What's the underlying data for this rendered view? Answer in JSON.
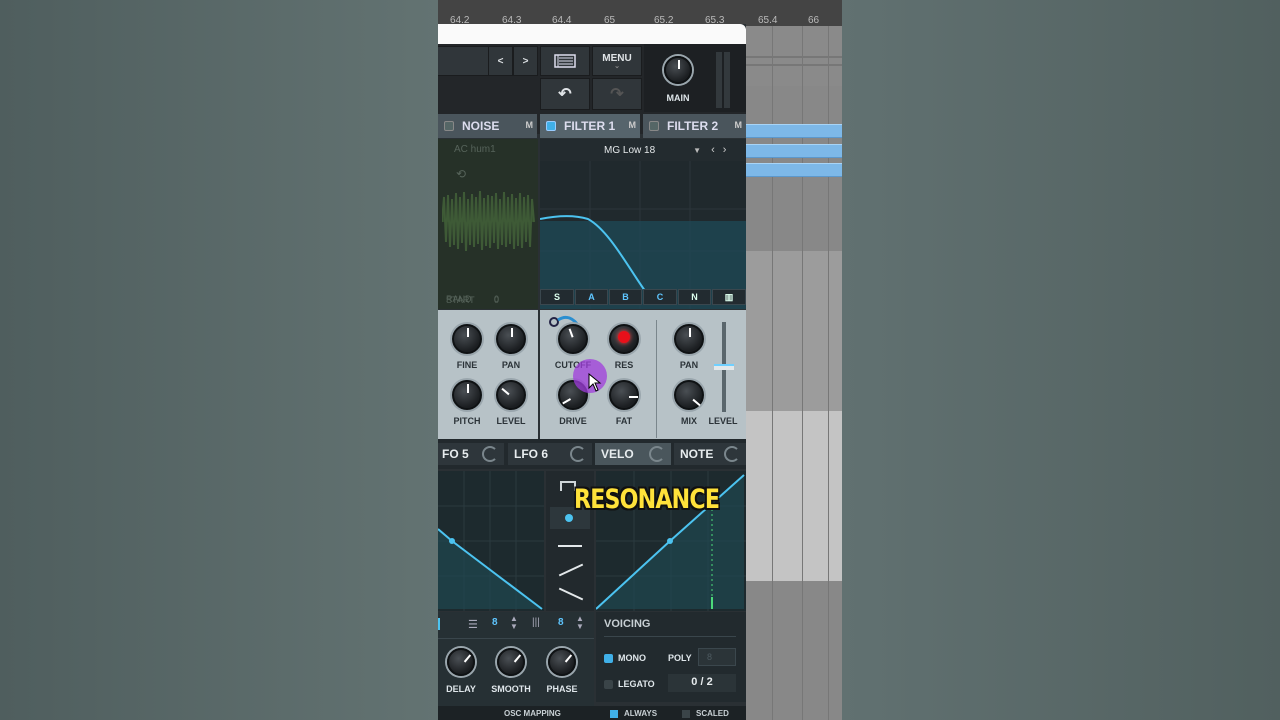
{
  "ruler": {
    "ticks": [
      "64.2",
      "64.3",
      "64.4",
      "65",
      "65.2",
      "65.3",
      "65.4",
      "66"
    ]
  },
  "toolbar": {
    "menu_label": "MENU",
    "main_label": "MAIN"
  },
  "sections": {
    "noise": {
      "title": "NOISE",
      "mute": "M",
      "sample": "AC hum1",
      "start_label": "START",
      "start_value": "0",
      "rand_label": "RAND",
      "rand_value": "0"
    },
    "filter1": {
      "title": "FILTER 1",
      "mute": "M",
      "type": "MG Low 18"
    },
    "filter2": {
      "title": "FILTER 2",
      "mute": "M"
    }
  },
  "filter_buttons": [
    "S",
    "A",
    "B",
    "C",
    "N"
  ],
  "noise_knobs": {
    "fine": "FINE",
    "pan": "PAN",
    "pitch": "PITCH",
    "level": "LEVEL"
  },
  "filter_knobs": {
    "cutoff": "CUTOFF",
    "res": "RES",
    "drive": "DRIVE",
    "fat": "FAT",
    "pan": "PAN",
    "mix": "MIX",
    "level": "LEVEL"
  },
  "mod_tabs": {
    "lfo5": "FO 5",
    "lfo6": "LFO 6",
    "velo": "VELO",
    "note": "NOTE"
  },
  "overlay_caption": "RESONANCE",
  "lfo_controls": {
    "grid1": "8",
    "grid2": "8",
    "delay": "DELAY",
    "smooth": "SMOOTH",
    "phase": "PHASE"
  },
  "voicing": {
    "title": "VOICING",
    "mono": "MONO",
    "poly": "POLY",
    "poly_value": "8",
    "legato": "LEGATO",
    "voice_count": "0 / 2"
  },
  "bottom": {
    "osc_mapping": "OSC MAPPING",
    "always": "ALWAYS",
    "scaled": "SCALED"
  },
  "colors": {
    "accent": "#40b0e8",
    "caption": "#ffe23a",
    "res_dot": "#e8101a"
  }
}
